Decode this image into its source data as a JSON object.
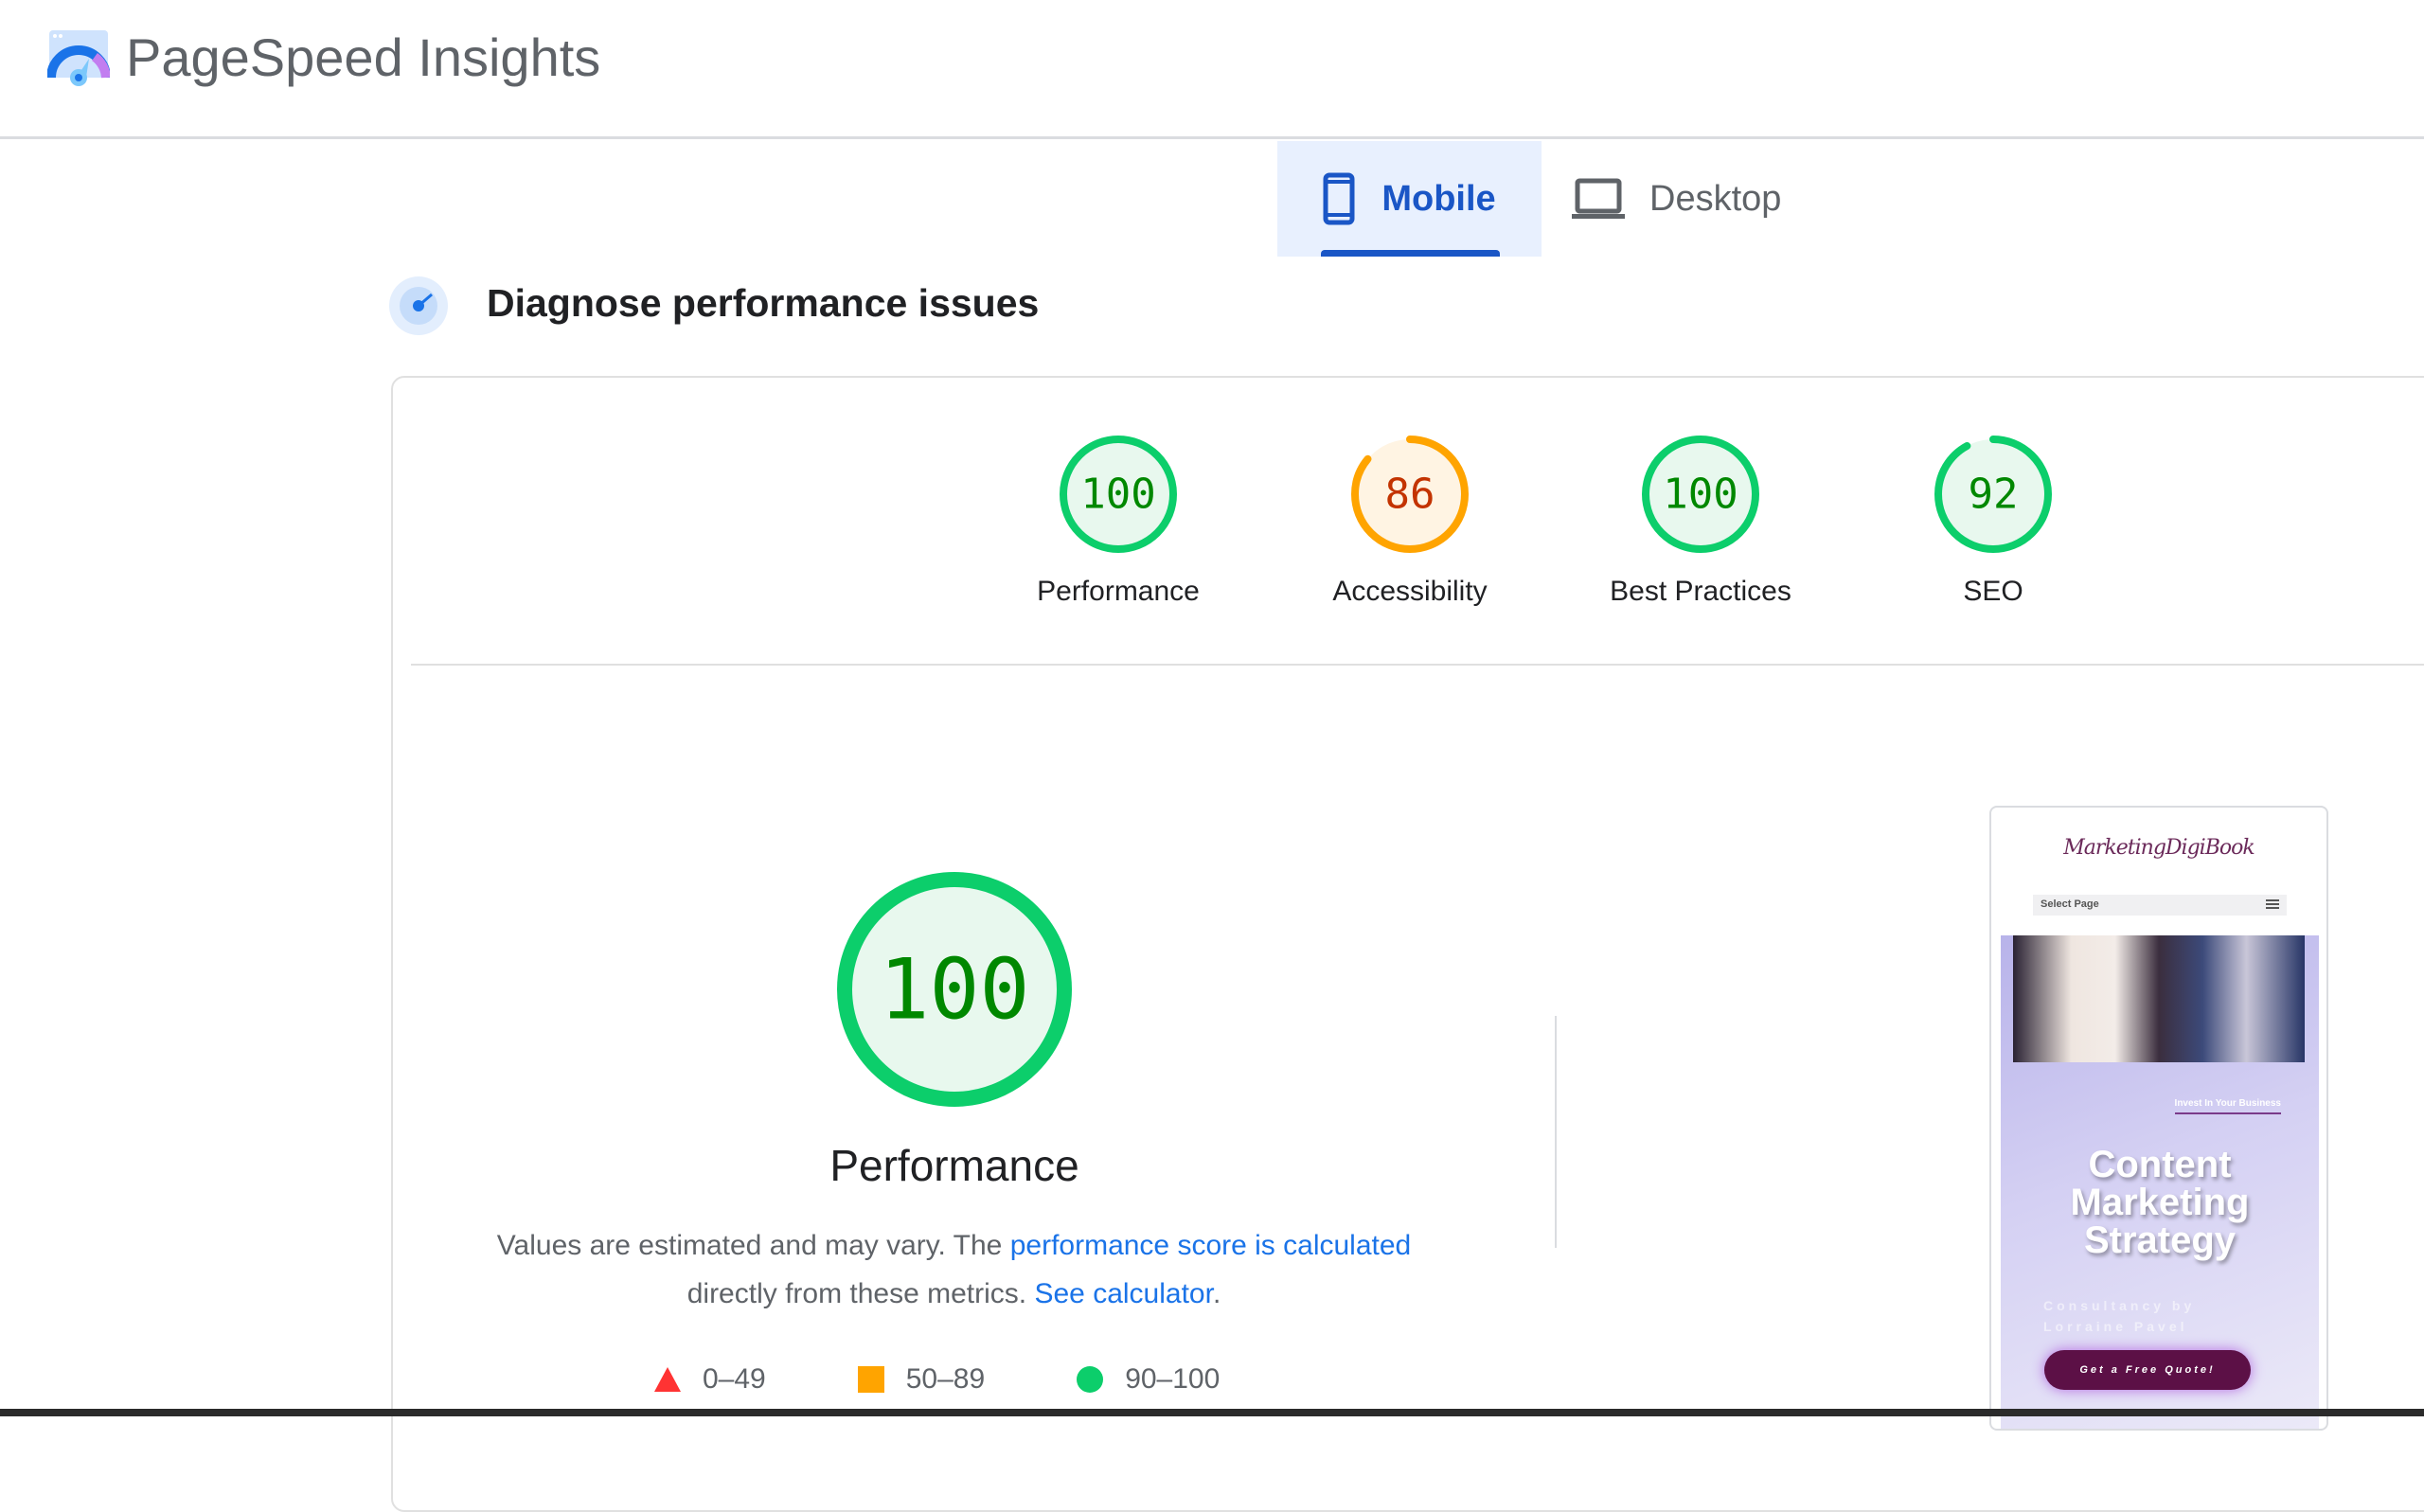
{
  "header": {
    "title": "PageSpeed Insights"
  },
  "tabs": [
    {
      "label": "Mobile",
      "icon": "smartphone-icon",
      "selected": true
    },
    {
      "label": "Desktop",
      "icon": "laptop-icon",
      "selected": false
    }
  ],
  "section": {
    "title": "Diagnose performance issues"
  },
  "categories": [
    {
      "label": "Performance",
      "score": "100",
      "value": 100,
      "rating": "pass"
    },
    {
      "label": "Accessibility",
      "score": "86",
      "value": 86,
      "rating": "average"
    },
    {
      "label": "Best Practices",
      "score": "100",
      "value": 100,
      "rating": "pass"
    },
    {
      "label": "SEO",
      "score": "92",
      "value": 92,
      "rating": "pass"
    }
  ],
  "performance": {
    "score": "100",
    "title": "Performance",
    "desc_1": "Values are estimated and may vary. The ",
    "link_1": "performance score is calculated",
    "desc_2": "directly from these metrics. ",
    "link_2": "See calculator",
    "desc_3": "."
  },
  "legend": [
    {
      "range": "0–49",
      "shape": "triangle",
      "color": "#ff3333"
    },
    {
      "range": "50–89",
      "shape": "square",
      "color": "#ffa400"
    },
    {
      "range": "90–100",
      "shape": "circle",
      "color": "#0cce6b"
    }
  ],
  "colors": {
    "pass": "#0cce6b",
    "pass_fill": "#e8f8ee",
    "pass_text": "#008800",
    "average": "#ffa400",
    "average_fill": "#fff4e3",
    "average_text": "#c33300",
    "accent": "#1a73e8"
  },
  "screenshot": {
    "logo": "MarketingDigiBook",
    "nav": "Select Page",
    "eyebrow": "Invest In Your Business",
    "headline": "Content Marketing Strategy",
    "subtitle": "Consultancy by Lorraine Pavel",
    "cta": "Get a Free Quote!"
  }
}
